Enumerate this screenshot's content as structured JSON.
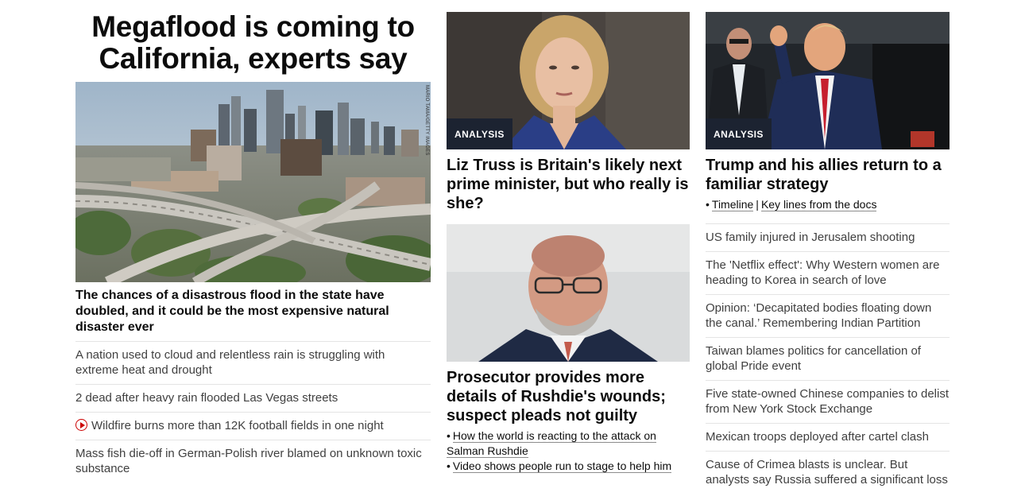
{
  "hero": {
    "title": "Megaflood is coming to California, experts say",
    "photo_credit": "MARIO TAMA/GETTY IMAGES",
    "headline": "The chances of a disastrous flood in the state have doubled, and it could be the most expensive natural disaster ever",
    "related": [
      "A nation used to cloud and relentless rain is struggling with extreme heat and drought",
      "2 dead after heavy rain flooded Las Vegas streets",
      "Wildfire burns more than 12K football fields in one night",
      "Mass fish die-off in German-Polish river blamed on unknown toxic substance"
    ]
  },
  "middle": {
    "card1": {
      "badge": "ANALYSIS",
      "title": "Liz Truss is Britain's likely next prime minister, but who really is she?"
    },
    "card2": {
      "title": "Prosecutor provides more details of Rushdie's wounds; suspect pleads not guilty",
      "links": [
        "How the world is reacting to the attack on Salman Rushdie",
        "Video shows people run to stage to help him"
      ]
    }
  },
  "right": {
    "card": {
      "badge": "ANALYSIS",
      "title": "Trump and his allies return to a familiar strategy",
      "links": [
        "Timeline",
        "Key lines from the docs"
      ],
      "separator": "|"
    },
    "headlines": [
      "US family injured in Jerusalem shooting",
      "The 'Netflix effect': Why Western women are heading to Korea in search of love",
      "Opinion: ‘Decapitated bodies floating down the canal.’ Remembering Indian Partition",
      "Taiwan blames politics for cancellation of global Pride event",
      "Five state-owned Chinese companies to delist from New York Stock Exchange",
      "Mexican troops deployed after cartel clash",
      "Cause of Crimea blasts is unclear. But analysts say Russia suffered a significant loss"
    ]
  },
  "colors": {
    "badge_bg": "#1c2331",
    "play_icon": "#cc0000",
    "divider": "#e4e4e4"
  }
}
